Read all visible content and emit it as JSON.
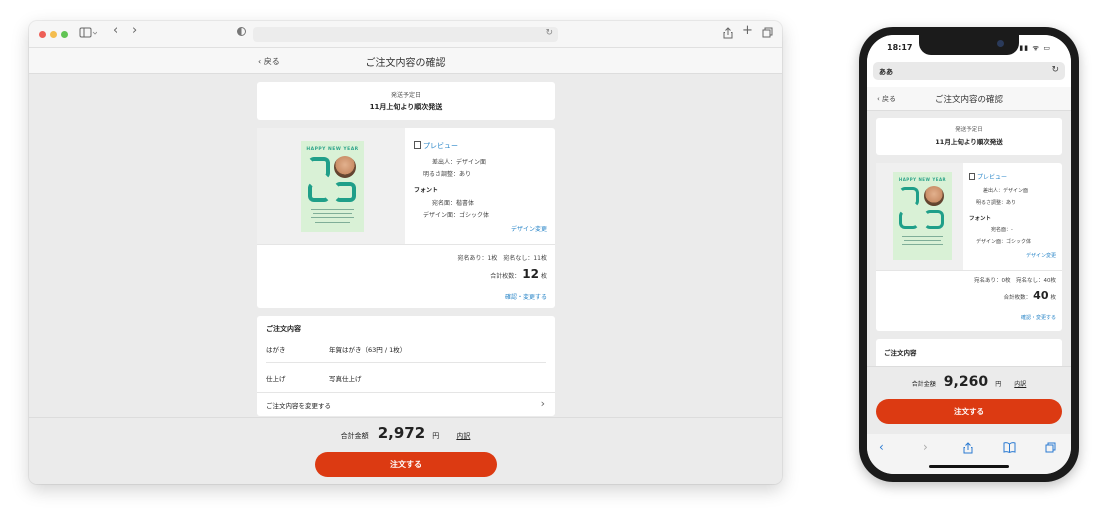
{
  "desktop": {
    "nav": {
      "sidebar_icon": "sidebar-icon",
      "back_arrow": "‹",
      "forward_arrow": "›",
      "share_icon": "share-icon",
      "new_tab": "+",
      "tabs_icon": "tabs-icon"
    },
    "header": {
      "back_label": "‹ 戻る",
      "title": "ご注文内容の確認"
    },
    "shipping": {
      "label": "発送予定日",
      "value": "11月上旬より順次発送"
    },
    "design": {
      "card_greeting": "HAPPY NEW YEAR",
      "preview_label": "プレビュー",
      "sender_label": "差出人：デザイン面",
      "brightness_label": "明るさ調整：あり",
      "font_heading": "フォント",
      "font_address": "宛名面：楷書体",
      "font_design": "デザイン面：ゴシック体",
      "change_design": "デザイン変更",
      "counts": "宛名あり：1枚　宛名なし：11枚",
      "total_label": "合計枚数：",
      "total_value": "12",
      "total_unit": "枚",
      "confirm_link": "確認・変更する"
    },
    "order": {
      "heading": "ご注文内容",
      "rows": [
        {
          "label": "はがき",
          "value": "年賀はがき（63円 / 1枚）"
        },
        {
          "label": "仕上げ",
          "value": "写真仕上げ"
        }
      ],
      "change_label": "ご注文内容を変更する"
    },
    "footer": {
      "total_label": "合計金額",
      "total_value": "2,972",
      "total_unit": "円",
      "breakdown": "内訳",
      "order_button": "注文する"
    }
  },
  "phone": {
    "status": {
      "time": "18:17",
      "signal": "▮▮ ᯤ ▭"
    },
    "url": {
      "aa": "ああ"
    },
    "header": {
      "back_label": "‹ 戻る",
      "title": "ご注文内容の確認"
    },
    "shipping": {
      "label": "発送予定日",
      "value": "11月上旬より順次発送"
    },
    "design": {
      "card_greeting": "HAPPY NEW YEAR",
      "preview_label": "プレビュー",
      "sender_label": "差出人：デザイン面",
      "brightness_label": "明るさ調整：あり",
      "font_heading": "フォント",
      "font_address": "宛名面：-",
      "font_design": "デザイン面：ゴシック体",
      "change_design": "デザイン変更",
      "counts": "宛名あり：0枚　宛名なし：40枚",
      "total_label": "合計枚数：",
      "total_value": "40",
      "total_unit": "枚",
      "confirm_link": "確認・変更する"
    },
    "order": {
      "heading": "ご注文内容"
    },
    "footer": {
      "total_label": "合計金額",
      "total_value": "9,260",
      "total_unit": "円",
      "breakdown": "内訳",
      "order_button": "注文する"
    }
  },
  "colors": {
    "accent": "#dc3a12",
    "link": "#2a86c8",
    "card_bg": "#d9f1d6",
    "card_teal": "#1f9f89"
  }
}
